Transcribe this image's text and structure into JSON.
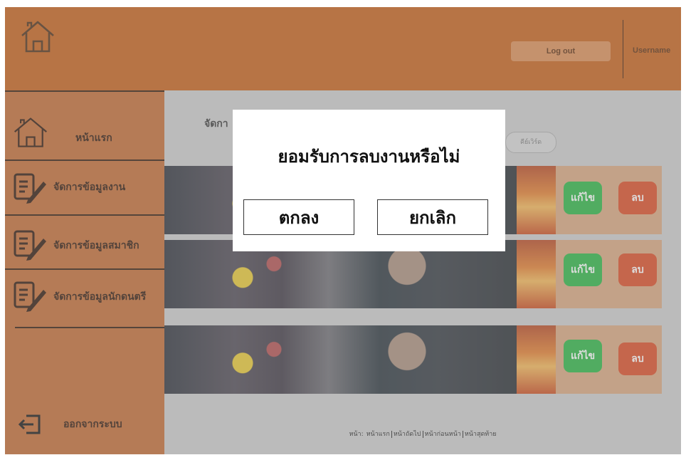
{
  "header": {
    "home_icon": "house-outline-icon",
    "logout_label": "Log out",
    "username": "Username"
  },
  "sidebar": {
    "items": [
      {
        "label": "หน้าแรก",
        "icon": "house-outline-icon"
      },
      {
        "label": "จัดการข้อมูลงาน",
        "icon": "document-pencil-icon"
      },
      {
        "label": "จัดการข้อมูลสมาชิก",
        "icon": "document-pencil-icon"
      },
      {
        "label": "จัดการข้อมูลนักดนตรี",
        "icon": "document-pencil-icon"
      }
    ],
    "logout": {
      "label": "ออกจากระบบ",
      "icon": "exit-arrow-icon"
    }
  },
  "main": {
    "heading": "จัดกา",
    "search_placeholder": "คีย์เวิร์ด",
    "cards": [
      {
        "edit_label": "แก้ไข",
        "delete_label": "ลบ"
      },
      {
        "edit_label": "แก้ไข",
        "delete_label": "ลบ"
      },
      {
        "edit_label": "แก้ไข",
        "delete_label": "ลบ"
      }
    ],
    "pagination": {
      "prefix": "หน้า:",
      "first": "หน้าแรก",
      "next": "หน้าถัดไป",
      "prev": "หน้าก่อนหน้า",
      "last": "หน้าสุดท้าย"
    }
  },
  "dialog": {
    "title": "ยอมรับการลบงานหรือไม่",
    "confirm_label": "ตกลง",
    "cancel_label": "ยกเลิก"
  },
  "colors": {
    "header_bg": "#c45c14",
    "sidebar_bg": "#c0672e",
    "edit_green": "#27b33f",
    "delete_red": "#d9471f"
  }
}
